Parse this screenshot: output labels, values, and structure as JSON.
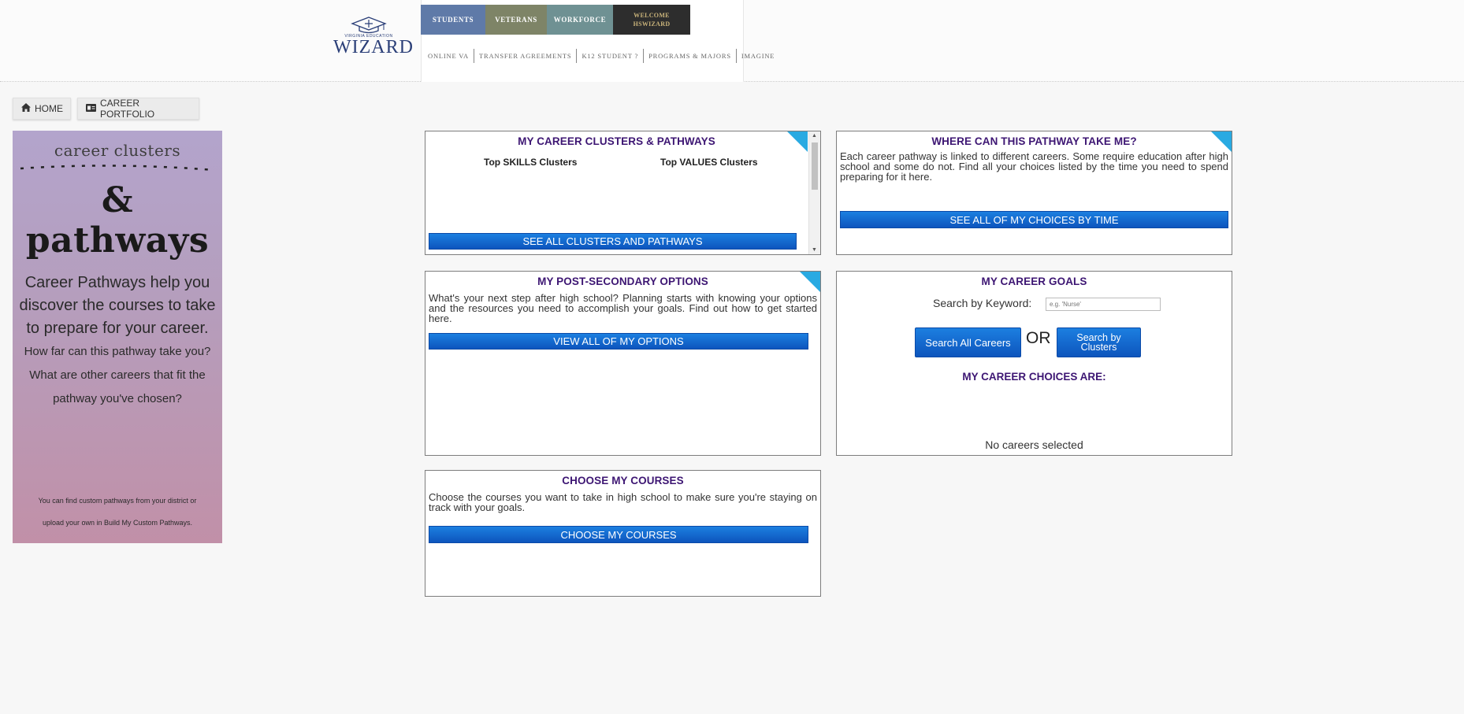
{
  "header": {
    "logo": {
      "small": "VIRGINIA EDUCATION",
      "big": "WIZARD"
    },
    "audience_tabs": [
      {
        "label": "STUDENTS",
        "color": "#5f7aa8"
      },
      {
        "label": "VETERANS",
        "color": "#7e8467"
      },
      {
        "label": "WORKFORCE",
        "color": "#6f9193"
      }
    ],
    "welcome": {
      "line1": "WELCOME",
      "line2": "HSWIZARD"
    },
    "secondary_nav": [
      "ONLINE VA",
      "TRANSFER AGREEMENTS",
      "K12 STUDENT ?",
      "PROGRAMS & MAJORS",
      "IMAGINE"
    ]
  },
  "toolbar": {
    "home_label": "HOME",
    "portfolio_label": "CAREER PORTFOLIO"
  },
  "sidebar": {
    "top": "career clusters",
    "title": "& pathways",
    "body": [
      "Career Pathways help you",
      "discover the courses to take",
      "to prepare for your career."
    ],
    "body2": [
      "How far can this pathway take you?",
      "What are other careers that fit the",
      "pathway you've chosen?"
    ],
    "footer": [
      "You can find custom pathways from your district or",
      "upload your own in Build My Custom Pathways."
    ]
  },
  "panels": {
    "clusters": {
      "title": "MY CAREER CLUSTERS & PATHWAYS",
      "col1": "Top SKILLS Clusters",
      "col2": "Top VALUES Clusters",
      "button": "SEE ALL CLUSTERS AND PATHWAYS"
    },
    "where": {
      "title": "WHERE CAN THIS PATHWAY TAKE ME?",
      "text": "Each career pathway is linked to different careers. Some require education after high school and some do not. Find all your choices listed by the time you need to spend preparing for it here.",
      "button": "SEE ALL OF MY CHOICES BY TIME"
    },
    "postsecondary": {
      "title": "MY POST-SECONDARY OPTIONS",
      "text": "What's your next step after high school? Planning starts with knowing your options and the resources you need to accomplish your goals. Find out how to get started here.",
      "button": "VIEW ALL OF MY OPTIONS"
    },
    "goals": {
      "title": "MY CAREER GOALS",
      "search_label": "Search by Keyword:",
      "search_placeholder": "e.g. 'Nurse'",
      "search_all": "Search All Careers",
      "or": "OR",
      "search_clusters": "Search by Clusters",
      "choices_title": "MY CAREER CHOICES ARE:",
      "empty": "No careers selected"
    },
    "courses": {
      "title": "CHOOSE MY COURSES",
      "text": "Choose the courses you want to take in high school to make sure you're staying on track with your goals.",
      "button": "CHOOSE MY COURSES"
    }
  },
  "colors": {
    "title_purple": "#3d1673",
    "button_blue": "#0d55bd",
    "corner_blue": "#29aae2",
    "welcome_bg": "#2d2d2d"
  }
}
